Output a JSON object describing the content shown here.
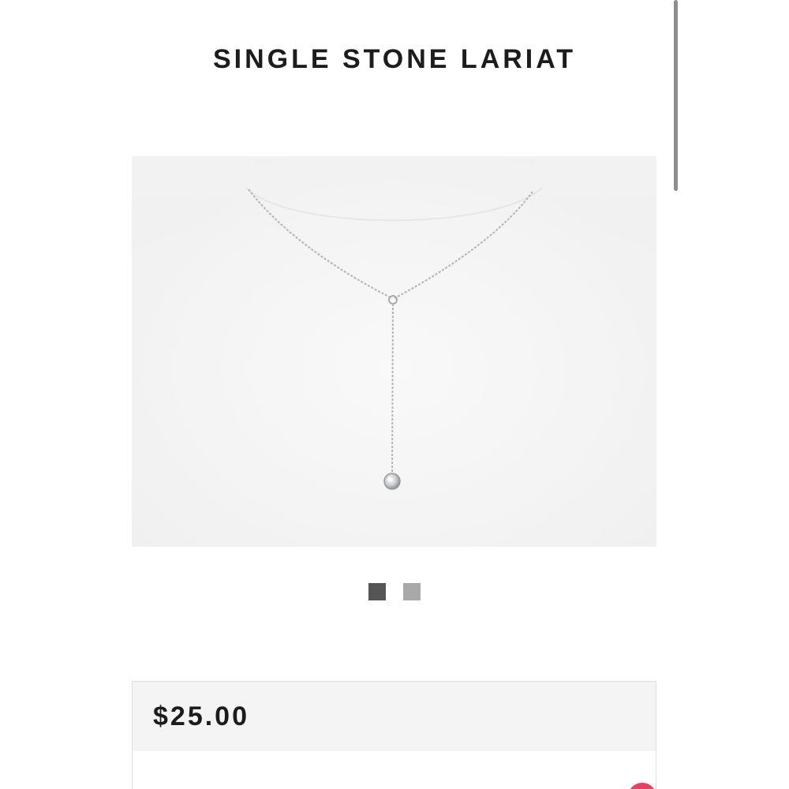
{
  "product": {
    "title": "SINGLE STONE LARIAT",
    "price": "$25.00",
    "image_alt": "Single stone lariat necklace on white display bust"
  },
  "carousel": {
    "count": 2,
    "active_index": 0
  },
  "colors": {
    "text": "#1c1c1c",
    "dot_active": "#555555",
    "dot_inactive": "#a9a9a9",
    "price_header_bg": "#f4f4f4",
    "badge": "#e8405f"
  }
}
